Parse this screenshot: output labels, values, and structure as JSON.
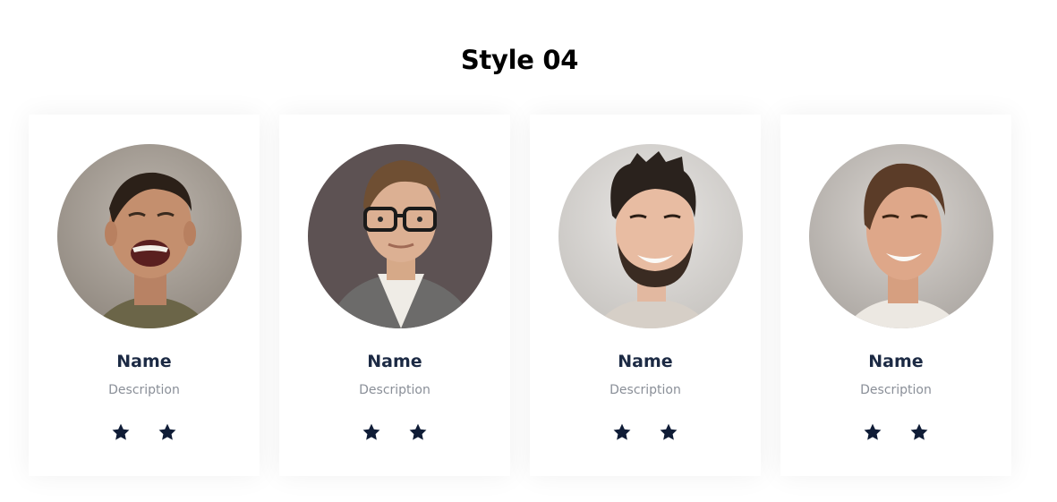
{
  "section": {
    "title": "Style 04"
  },
  "colors": {
    "name": "#1c2a44",
    "description": "#8a8f98",
    "star": "#0f1c36"
  },
  "cards": [
    {
      "name": "Name",
      "description": "Description",
      "rating": 2,
      "avatar_icon": "man-laughing-photo"
    },
    {
      "name": "Name",
      "description": "Description",
      "rating": 2,
      "avatar_icon": "man-glasses-photo"
    },
    {
      "name": "Name",
      "description": "Description",
      "rating": 2,
      "avatar_icon": "man-beard-smiling-photo"
    },
    {
      "name": "Name",
      "description": "Description",
      "rating": 2,
      "avatar_icon": "man-smiling-photo"
    }
  ]
}
